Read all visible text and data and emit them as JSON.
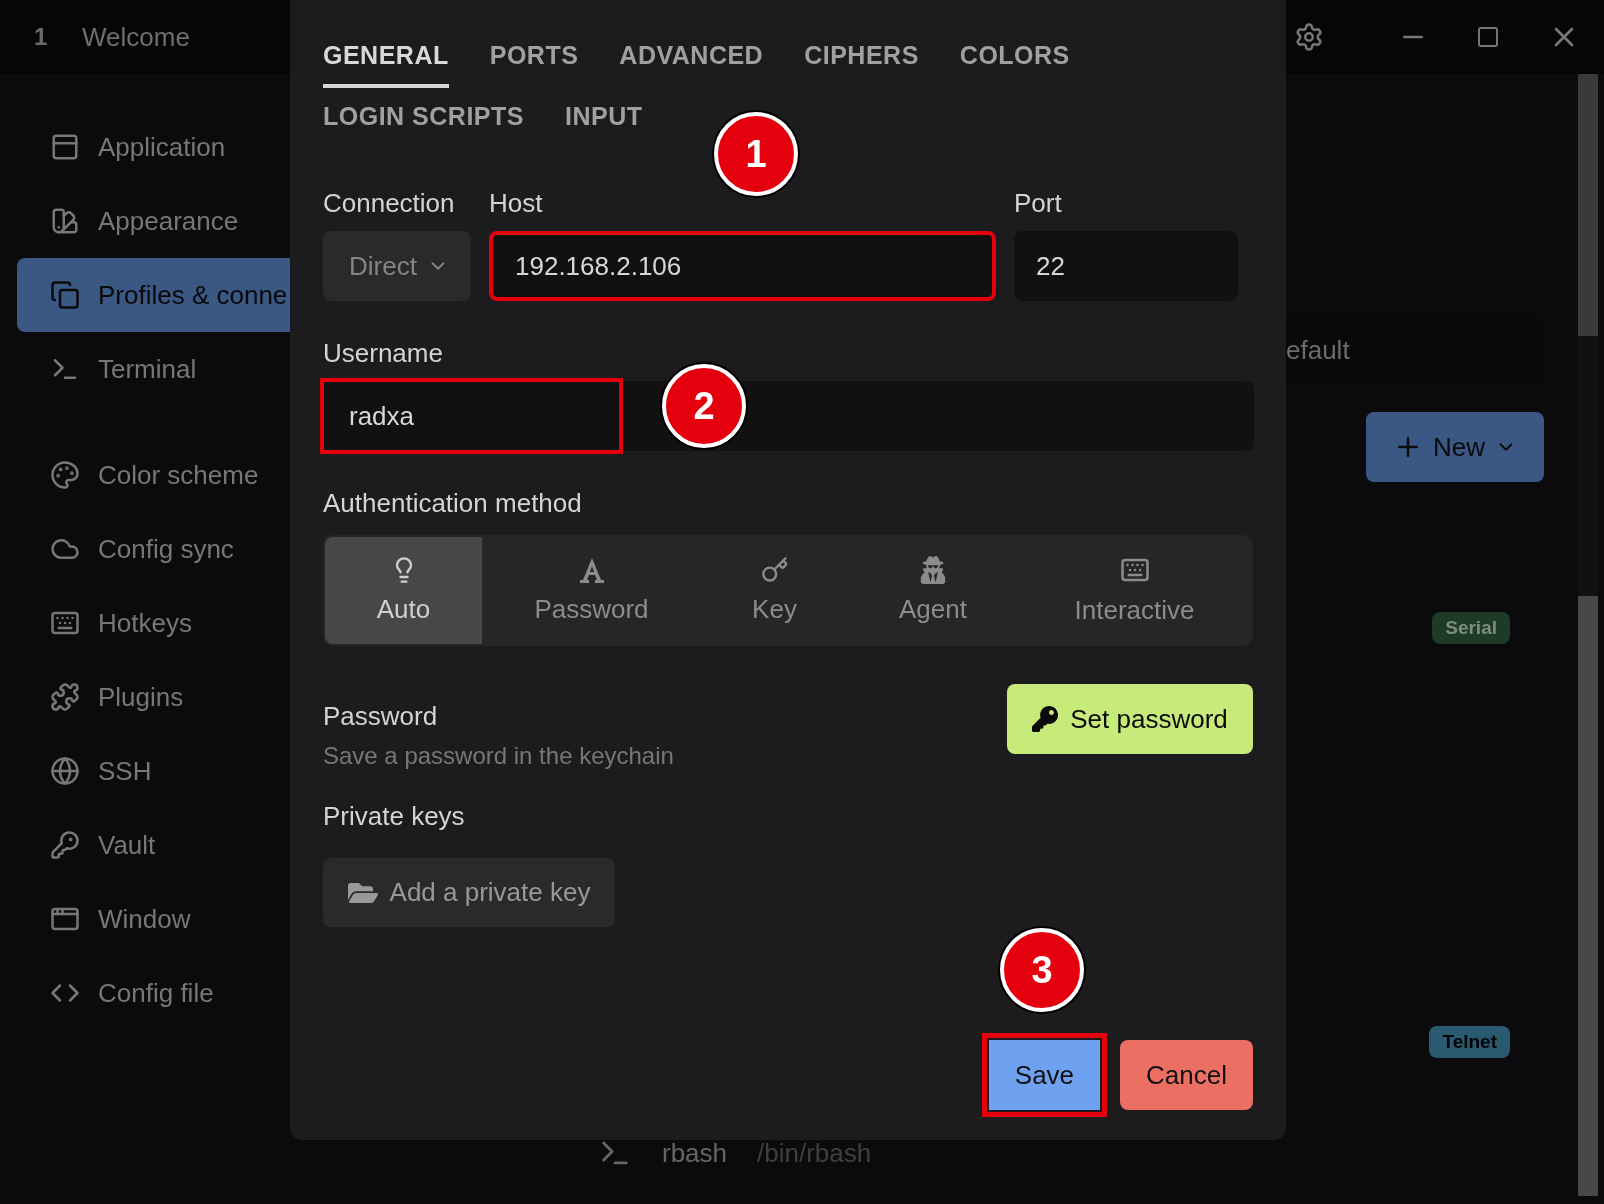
{
  "title_bar": {
    "tab_number": "1",
    "tab_title": "Welcome"
  },
  "sidebar": {
    "groups": [
      {
        "items": [
          {
            "label": "Application",
            "selected": false
          },
          {
            "label": "Appearance",
            "selected": false
          },
          {
            "label": "Profiles & conne",
            "selected": true
          },
          {
            "label": "Terminal",
            "selected": false
          }
        ]
      },
      {
        "items": [
          {
            "label": "Color scheme",
            "selected": false
          },
          {
            "label": "Config sync",
            "selected": false
          },
          {
            "label": "Hotkeys",
            "selected": false
          },
          {
            "label": "Plugins",
            "selected": false
          },
          {
            "label": "SSH",
            "selected": false
          },
          {
            "label": "Vault",
            "selected": false
          },
          {
            "label": "Window",
            "selected": false
          },
          {
            "label": "Config file",
            "selected": false
          }
        ]
      }
    ]
  },
  "background": {
    "profile_field": "efault",
    "new_button": "New",
    "tags": [
      {
        "label": "Serial",
        "color": "#1e3b27"
      },
      {
        "label": "Telnet",
        "color": "#2a5a70"
      }
    ],
    "profile_row": {
      "name": "rbash",
      "command": "/bin/rbash"
    }
  },
  "dialog": {
    "tab_rows": [
      {
        "tabs": [
          {
            "label": "GENERAL",
            "selected": true
          },
          {
            "label": "PORTS",
            "selected": false
          },
          {
            "label": "ADVANCED",
            "selected": false
          },
          {
            "label": "CIPHERS",
            "selected": false
          },
          {
            "label": "COLORS",
            "selected": false
          }
        ]
      },
      {
        "tabs": [
          {
            "label": "LOGIN SCRIPTS",
            "selected": false
          },
          {
            "label": "INPUT",
            "selected": false
          }
        ]
      }
    ],
    "connection": {
      "label": "Connection",
      "value": "Direct"
    },
    "host": {
      "label": "Host",
      "value": "192.168.2.106",
      "highlighted": true
    },
    "port": {
      "label": "Port",
      "value": "22",
      "highlighted": false
    },
    "username": {
      "label": "Username",
      "value": "radxa",
      "highlighted": true
    },
    "auth": {
      "label": "Authentication method",
      "options": [
        {
          "label": "Auto",
          "selected": true
        },
        {
          "label": "Password",
          "selected": false
        },
        {
          "label": "Key",
          "selected": false
        },
        {
          "label": "Agent",
          "selected": false
        },
        {
          "label": "Interactive",
          "selected": false
        }
      ]
    },
    "password": {
      "title": "Password",
      "description": "Save a password in the keychain",
      "button": "Set password"
    },
    "private_keys": {
      "title": "Private keys",
      "button": "Add a private key"
    },
    "buttons": [
      {
        "label": "Save",
        "kind": "primary",
        "highlighted": true
      },
      {
        "label": "Cancel",
        "kind": "danger",
        "highlighted": false
      }
    ]
  },
  "callouts": [
    {
      "number": "1"
    },
    {
      "number": "2"
    },
    {
      "number": "3"
    }
  ]
}
